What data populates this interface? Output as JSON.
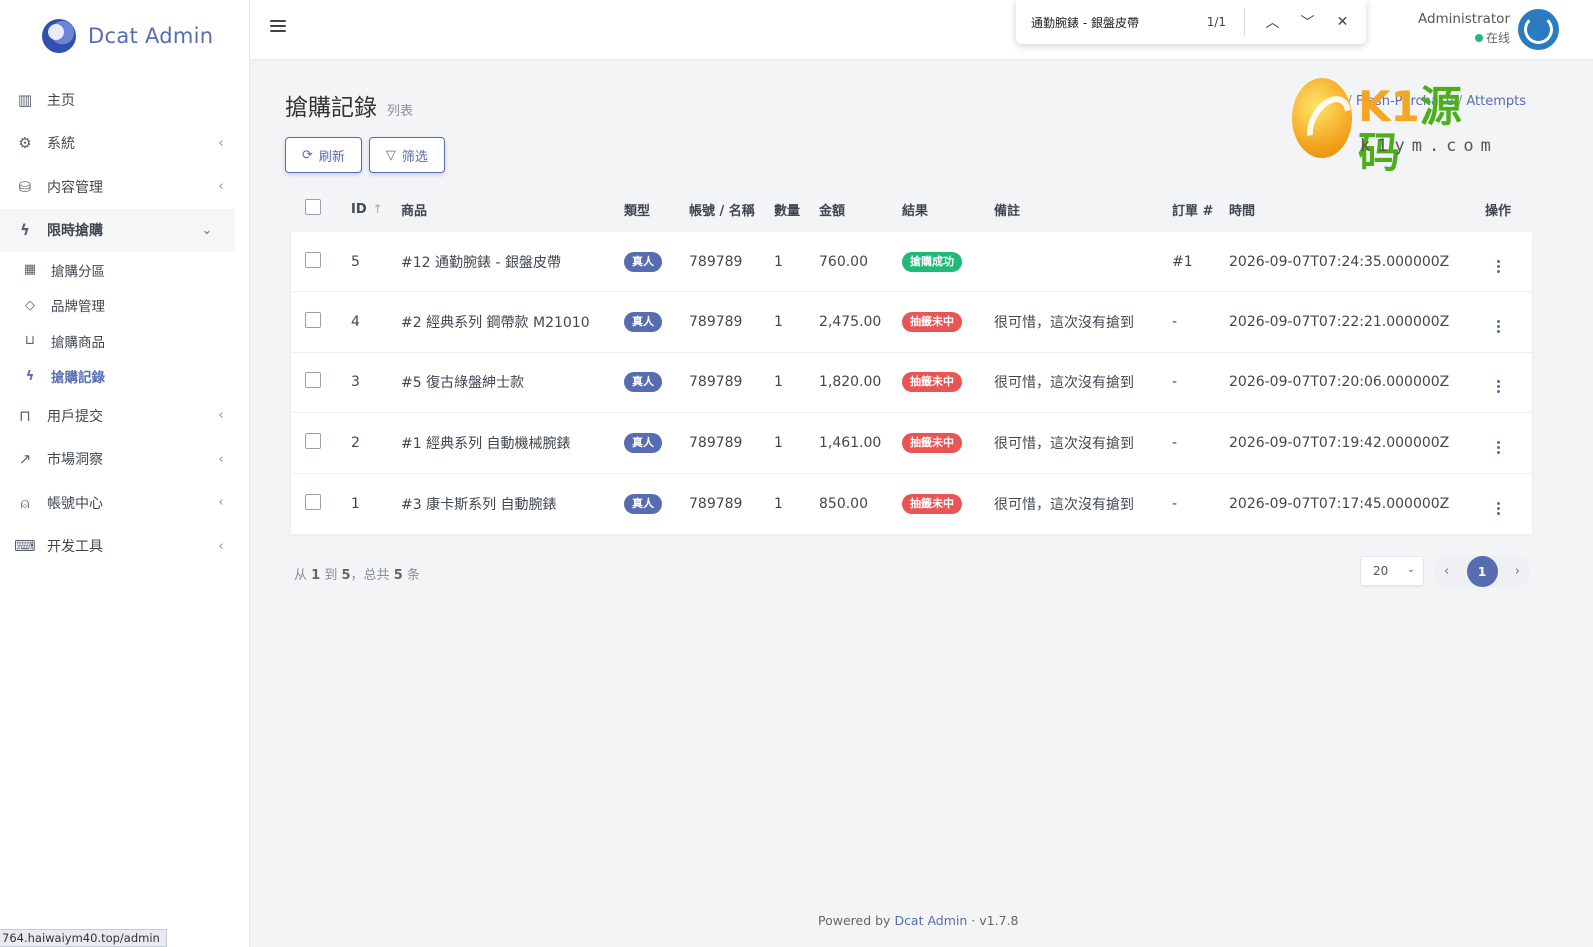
{
  "brand": {
    "name": "Dcat Admin"
  },
  "sidebar": {
    "items": [
      {
        "label": "主页",
        "icon": "bar-chart-icon",
        "caret": ""
      },
      {
        "label": "系統",
        "icon": "gear-icon",
        "caret": "‹"
      },
      {
        "label": "内容管理",
        "icon": "database-icon",
        "caret": "‹"
      },
      {
        "label": "限時搶購",
        "icon": "lightning-icon",
        "caret": "⌄"
      }
    ],
    "subitems": [
      {
        "label": "搶購分區",
        "icon": "grid-icon"
      },
      {
        "label": "品牌管理",
        "icon": "tag-icon"
      },
      {
        "label": "搶購商品",
        "icon": "cart-icon"
      },
      {
        "label": "搶購記錄",
        "icon": "lightning-icon"
      }
    ],
    "items_after": [
      {
        "label": "用戶提交",
        "icon": "inbox-icon",
        "caret": "‹"
      },
      {
        "label": "市場洞察",
        "icon": "trend-icon",
        "caret": "‹"
      },
      {
        "label": "帳號中心",
        "icon": "user-icon",
        "caret": "‹"
      },
      {
        "label": "开发工具",
        "icon": "keyboard-icon",
        "caret": "‹"
      }
    ]
  },
  "status_url": "764.haiwaiym40.top/admin",
  "topbar": {
    "user_name": "Administrator",
    "user_status": "在线"
  },
  "findbar": {
    "query": "通勤腕錶 - 銀盤皮帶",
    "count": "1/1"
  },
  "page": {
    "title": "搶購記錄",
    "subtitle": "列表",
    "breadcrumb_prefix": "/",
    "breadcrumb_1": "Flash-Purchase",
    "breadcrumb_sep": "/",
    "breadcrumb_2": "Attempts"
  },
  "watermark": {
    "brand_k": "K1",
    "brand_cn": "源码",
    "domain": "k1ym.com"
  },
  "toolbar": {
    "refresh_label": "刷新",
    "filter_label": "筛选"
  },
  "table": {
    "headers": {
      "id": "ID",
      "product": "商品",
      "type": "類型",
      "account": "帳號 / 名稱",
      "qty": "數量",
      "amount": "金額",
      "result": "結果",
      "note": "備註",
      "order": "訂單 #",
      "time": "時間",
      "actions": "操作"
    },
    "rows": [
      {
        "id": "5",
        "product": "#12 通勤腕錶 - 銀盤皮帶",
        "type": "真人",
        "account": "789789",
        "qty": "1",
        "amount": "760.00",
        "result": "搶購成功",
        "result_ok": true,
        "note": "",
        "order": "#1",
        "time": "2026-09-07T07:24:35.000000Z"
      },
      {
        "id": "4",
        "product": "#2 經典系列 鋼帶款 M21010",
        "type": "真人",
        "account": "789789",
        "qty": "1",
        "amount": "2,475.00",
        "result": "抽籤未中",
        "result_ok": false,
        "note": "很可惜，這次沒有搶到",
        "order": "-",
        "time": "2026-09-07T07:22:21.000000Z"
      },
      {
        "id": "3",
        "product": "#5 復古綠盤紳士款",
        "type": "真人",
        "account": "789789",
        "qty": "1",
        "amount": "1,820.00",
        "result": "抽籤未中",
        "result_ok": false,
        "note": "很可惜，這次沒有搶到",
        "order": "-",
        "time": "2026-09-07T07:20:06.000000Z"
      },
      {
        "id": "2",
        "product": "#1 經典系列 自動機械腕錶",
        "type": "真人",
        "account": "789789",
        "qty": "1",
        "amount": "1,461.00",
        "result": "抽籤未中",
        "result_ok": false,
        "note": "很可惜，這次沒有搶到",
        "order": "-",
        "time": "2026-09-07T07:19:42.000000Z"
      },
      {
        "id": "1",
        "product": "#3 康卡斯系列 自動腕錶",
        "type": "真人",
        "account": "789789",
        "qty": "1",
        "amount": "850.00",
        "result": "抽籤未中",
        "result_ok": false,
        "note": "很可惜，這次沒有搶到",
        "order": "-",
        "time": "2026-09-07T07:17:45.000000Z"
      }
    ]
  },
  "pagination": {
    "info_from": "从",
    "from": "1",
    "info_to": "到",
    "to": "5",
    "info_total": "，总共",
    "total": "5",
    "info_unit": "条",
    "per_page": "20",
    "current": "1"
  },
  "footer": {
    "powered_prefix": "Powered by",
    "powered_link": "Dcat Admin",
    "sep": "·",
    "version": "v1.7.8"
  },
  "colors": {
    "primary": "#586cb1",
    "success": "#21b978",
    "danger": "#ea5455"
  }
}
